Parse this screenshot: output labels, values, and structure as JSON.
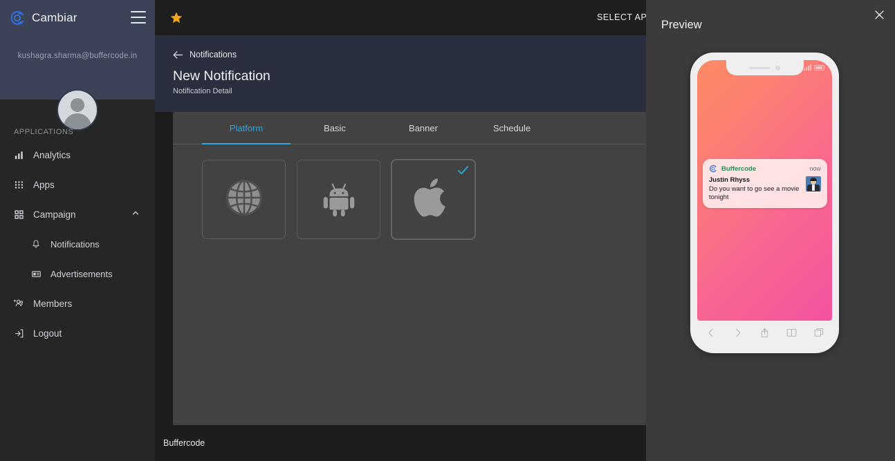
{
  "sidebar": {
    "brand": "Cambiar",
    "menu_icon": "hamburger-icon",
    "user_email": "kushagra.sharma@buffercode.in",
    "section_label": "APPLICATIONS",
    "items": [
      {
        "label": "Analytics",
        "icon": "bar-chart-icon"
      },
      {
        "label": "Apps",
        "icon": "grid-icon"
      },
      {
        "label": "Campaign",
        "icon": "dashboard-icon",
        "expanded": true,
        "chevron": "chevron-up-icon"
      },
      {
        "label": "Notifications",
        "icon": "bell-icon",
        "sub": true
      },
      {
        "label": "Advertisements",
        "icon": "ad-card-icon",
        "sub": true
      },
      {
        "label": "Members",
        "icon": "members-icon"
      },
      {
        "label": "Logout",
        "icon": "logout-icon"
      }
    ]
  },
  "topbar": {
    "star_icon": "star-icon",
    "select_app": "SELECT APP"
  },
  "content": {
    "breadcrumb": "Notifications",
    "back_icon": "arrow-left-icon",
    "title": "New Notification",
    "subtitle": "Notification Detail"
  },
  "tabs": [
    {
      "label": "Platform",
      "active": true
    },
    {
      "label": "Basic",
      "active": false
    },
    {
      "label": "Banner",
      "active": false
    },
    {
      "label": "Schedule",
      "active": false
    }
  ],
  "platforms": [
    {
      "name": "Web",
      "icon": "globe-icon",
      "selected": false
    },
    {
      "name": "Android",
      "icon": "android-icon",
      "selected": false
    },
    {
      "name": "iOS",
      "icon": "apple-icon",
      "selected": true
    }
  ],
  "footer": {
    "app_name": "Buffercode"
  },
  "preview": {
    "title": "Preview",
    "close_icon": "close-icon",
    "notification": {
      "app_name": "Buffercode",
      "app_logo": "buffercode-logo-icon",
      "time": "now",
      "sender": "Justin Rhyss",
      "message": "Do you want to go see a movie tonight",
      "thumbnail": "avatar-thumbnail"
    },
    "browser_bar": [
      {
        "name": "back",
        "icon": "chevron-left-icon"
      },
      {
        "name": "forward",
        "icon": "chevron-right-icon"
      },
      {
        "name": "share",
        "icon": "share-icon"
      },
      {
        "name": "bookmarks",
        "icon": "book-icon"
      },
      {
        "name": "tabs",
        "icon": "tabs-icon"
      }
    ]
  },
  "colors": {
    "accent": "#29a7e1",
    "sidebar_top": "#3c4257",
    "sidebar_body": "#262626",
    "content_header": "#2a2f3f",
    "card": "#424242",
    "star": "#f5a623",
    "app_name_green": "#2d8a52"
  }
}
